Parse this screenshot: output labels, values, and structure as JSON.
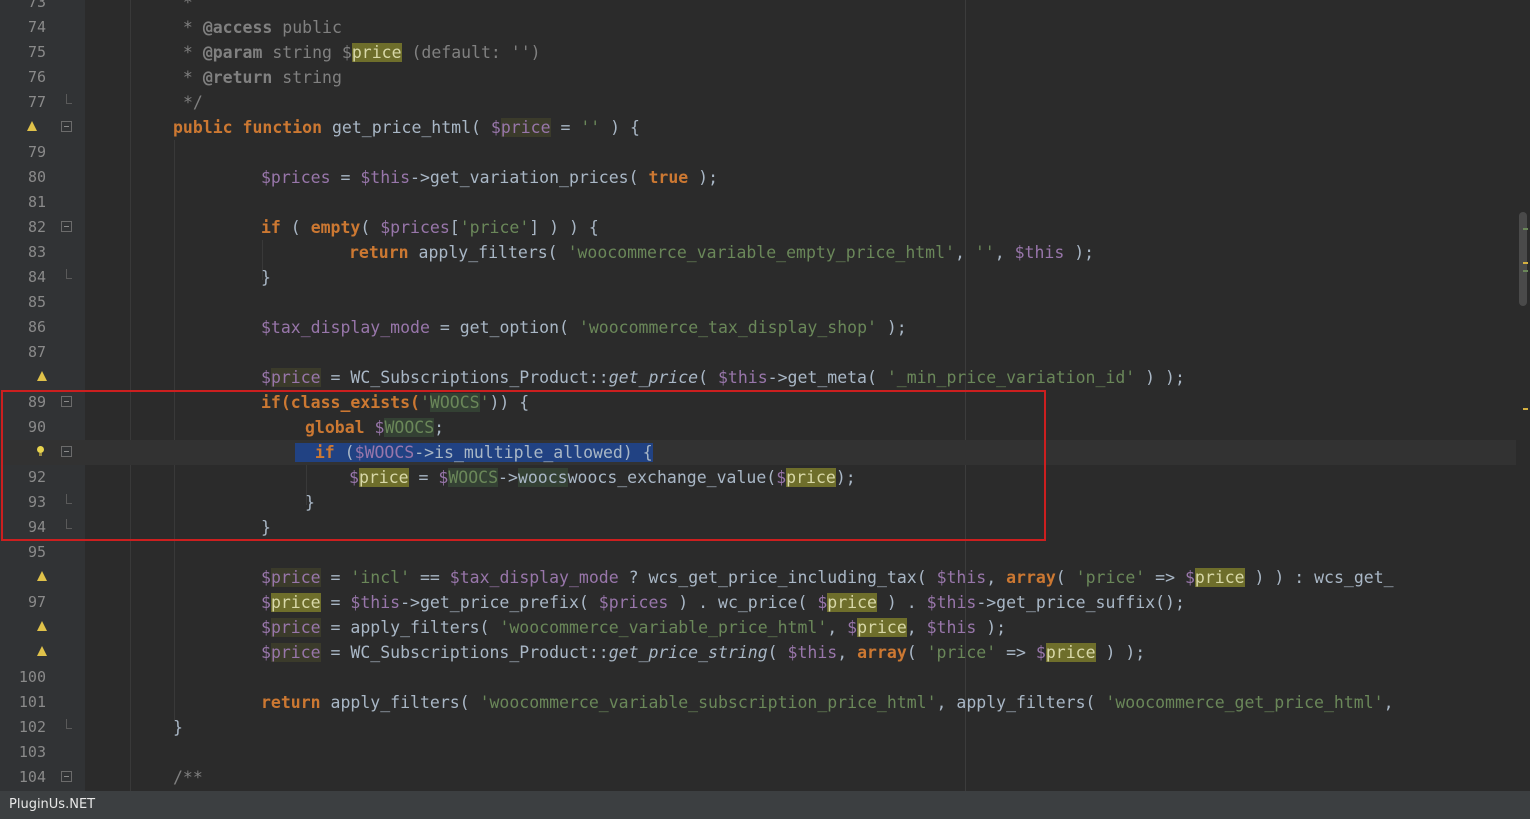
{
  "lines": {
    "l73": "73",
    "l74": "74",
    "l75": "75",
    "l76": "76",
    "l77": "77",
    "l79": "79",
    "l80": "80",
    "l81": "81",
    "l82": "82",
    "l83": "83",
    "l84": "84",
    "l85": "85",
    "l86": "86",
    "l87": "87",
    "l89": "89",
    "l90": "90",
    "l92": "92",
    "l93": "93",
    "l94": "94",
    "l95": "95",
    "l97": "97",
    "l100": "100",
    "l101": "101",
    "l102": "102",
    "l103": "103",
    "l104": "104"
  },
  "code": {
    "access_tag": "@access",
    "public_word": "public",
    "param_tag": "@param",
    "string_word": "string",
    "price_name": "price",
    "default_note": "(default: '')",
    "return_tag": "@return",
    "doc_close": "*/",
    "public_kw": "public",
    "function_kw": "function",
    "fn_name": "get_price_html",
    "empty_str": "''",
    "prices_var": "$prices",
    "this_var": "$this",
    "get_variation_prices": "->get_variation_prices(",
    "true_kw": "true",
    "if_kw": "if",
    "empty_fn": "empty",
    "price_key": "'price'",
    "return_kw": "return",
    "apply_filters": "apply_filters(",
    "wc_var_empty_filter": "'woocommerce_variable_empty_price_html'",
    "tax_display_var": "$tax_display_mode",
    "get_option": "get_option(",
    "tax_display_shop": "'woocommerce_tax_display_shop'",
    "wc_sub_class": "WC_Subscriptions_Product::",
    "get_price_fn": "get_price",
    "get_meta": "->get_meta(",
    "min_price_variation": "'_min_price_variation_id'",
    "class_exists": "if(class_exists(",
    "woocs_str": "WOOCS",
    "global_kw": "global",
    "woocs_var": "WOOCS",
    "is_multiple_allowed": "->is_multiple_allowed) {",
    "woocs_exchange": "woocs_exchange_value(",
    "incl_str": "'incl'",
    "wcs_incl": "? wcs_get_price_including_tax(",
    "array_kw": "array",
    "wcs_get_tail": ": wcs_get_",
    "get_price_prefix": "->get_price_prefix(",
    "wc_price": ". wc_price(",
    "get_price_suffix": "->get_price_suffix();",
    "wc_var_price_filter": "'woocommerce_variable_price_html'",
    "get_price_string": "get_price_string",
    "wc_var_sub_filter": "'woocommerce_variable_subscription_price_html'",
    "wc_get_price_filter": "'woocommerce_get_price_html'",
    "doc_open": "/**"
  },
  "footer": {
    "label": "PluginUs.NET"
  },
  "colors": {
    "background": "#2b2b2b",
    "gutter": "#313335",
    "keyword": "#cc7832",
    "string": "#6a8759",
    "variable": "#9876aa",
    "comment": "#808080",
    "annotation_box": "#cc1f1f",
    "selection": "#214283"
  }
}
